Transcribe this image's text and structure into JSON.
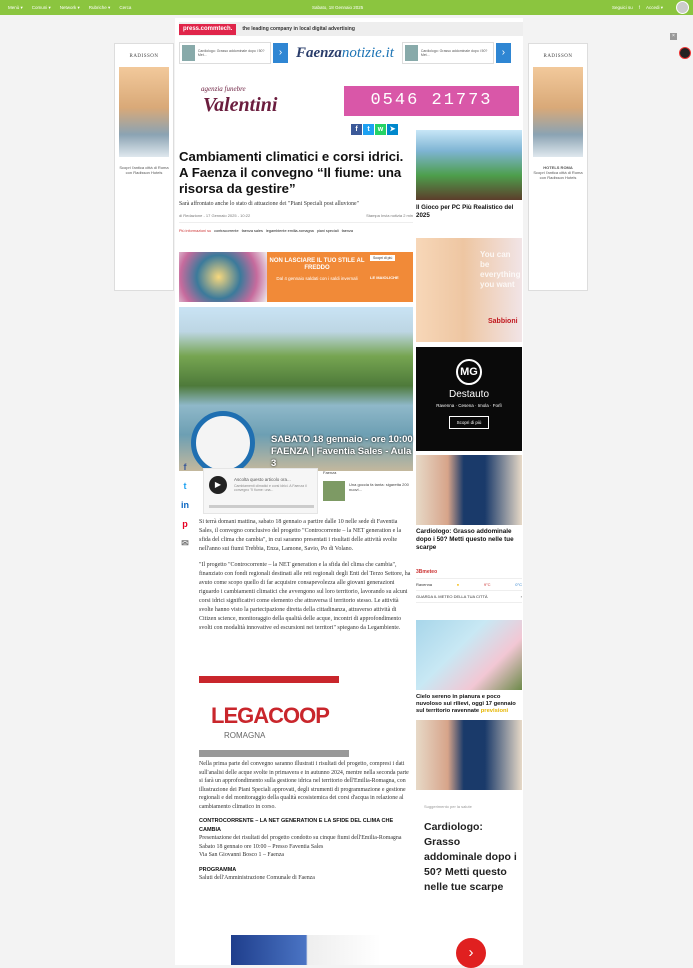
{
  "topbar": {
    "menu": [
      "Menù ▾",
      "Comuni ▾",
      "Network ▾",
      "Rubriche ▾",
      "Cerca"
    ],
    "date": "Sabato, 18 Gennaio 2025",
    "right": [
      "Seguici su",
      "f",
      "Accedi ▾"
    ]
  },
  "press": {
    "logo": "press.commtech.",
    "tagline": "the leading company in local digital advertising"
  },
  "faenza": {
    "card_left": "Cardiologo: Grasso addominale dopo i 50? Met...",
    "card_right": "Cardiologo: Grasso addominale dopo i 50? Met...",
    "logo_main": "Faenza",
    "logo_suffix": "notizie.it"
  },
  "funebre": {
    "top": "agenzia funebre",
    "name": "Valentini",
    "phone": "0546 21773"
  },
  "ads": {
    "hotel_name": "RADISSON",
    "hotel_sub": "HOTELS ROMA",
    "hotel_text": "Scopri l'antica città di Roma con Radisson Hotels",
    "promo_title": "NON LASCIARE IL TUO STILE AL FREDDO",
    "promo_sub": "Dal 4 gennaio saldati con i saldi invernali",
    "promo_brand": "LE MAIOLICHE",
    "promo_btn": "Scopri di più",
    "legacoop": "LEGACOOP",
    "legacoop_sub": "ROMAGNA"
  },
  "article": {
    "title": "Cambiamenti climatici e corsi idrici. A Faenza il convegno “Il fiume: una risorsa da gestire”",
    "subtitle": "Sarà affrontato anche lo stato di attuazione dei \"Piani Speciali post alluvione\"",
    "author": "di Redazione - 17 Gennaio 2025 - 10:22",
    "actions": "Stampa   Invia notizia   2 min",
    "tags_label": "Più informazioni su",
    "tags": [
      "contracorrente",
      "faenza sales",
      "legambiente emilia-romagna",
      "piani speciali",
      "faenza"
    ],
    "hero_text": "SABATO 18 gennaio - ore 10:00\nFAENZA | Faventia Sales - Aula 3",
    "p1": "Si terrà domani mattina, sabato 18 gennaio a partire dalle 10 nelle sede di Faventia Sales, il convegno conclusivo del progetto \"Controcorrente – la NET generation e la sfida del clima che cambia\", in cui saranno presentati i risultati delle attività svolte nell'anno sui fiumi Trebbia, Enza, Lamone, Savio, Po di Volano.",
    "p2": "\"Il progetto \"Controcorrente – la NET generation e la sfida del clima che cambia\", finanziato con fondi regionali destinati alle reti regionali degli Enti del Terzo Settore, ha avuto come scopo quello di far acquisire consapevolezza alle giovani generazioni riguardo i cambiamenti climatici che avvengono sul loro territorio, lavorando su alcuni corsi idrici significativi come elemento che attraversa il territorio stesso. Le attività svolte hanno visto la partecipazione diretta della cittadinanza, attraverso attività di Citizen science, monitoraggio della qualità delle acque, incontri di approfondimento svolti con modalità innovative ed escursioni nei territori\" spiegano da Legambiente.",
    "p3": "Nella prima parte del convegno saranno illustrati i risultati del progetto, compresi i dati sull'analisi delle acque svolte in primavera e in autunno 2024, mentre nella seconda parte si farà un approfondimento sulla gestione idrica nel territorio dell'Emilia-Romagna, con illustrazione dei Piani Speciali approvati, degli strumenti di programmazione e gestione regionali e del monitoraggio della qualità ecosistemica dei corsi d'acqua in relazione al cambiamento climatico in corso.",
    "h1": "CONTROCORRENTE – LA NET GENERATION E LA SFIDE DEL CLIMA CHE CAMBIA",
    "p4": "Presentazione dei risultati del progetto condotto su cinque fiumi dell'Emilia-Romagna\nSabato 18 gennaio ore 10:00 – Presso Faventia Sales\nVia San Giovanni Bosco 1 – Faenza",
    "h2": "PROGRAMMA",
    "p5": "Saluti dell'Amministrazione Comunale di Faenza"
  },
  "audio": {
    "title": "Ascolta questo articolo ora...",
    "desc": "Cambiamenti climatici e corsi idrici. A Faenza il convegno \"Il fiume: una...",
    "related_label": "Faenza",
    "related_text": "Una goccia fa tanta: sigaretta 200 nuovi..."
  },
  "sidebar": {
    "game_title": "Il Gioco per PC Più Realistico del 2025",
    "beauty_text": "You can be everything you want",
    "beauty_brand": "Sabbioni",
    "dest_name": "Destauto",
    "dest_cities": "Ravenna · Cesena · Imola · Forlì",
    "dest_btn": "Scopri di più",
    "doctor_title": "Cardiologo: Grasso addominale dopo i 50? Metti questo nelle tue scarpe",
    "meteo_logo": "3Bmeteo",
    "meteo_city": "Ravenna",
    "meteo_min": "9°C",
    "meteo_max": "0°C",
    "meteo_link": "GUARDA IL METEO DELLA TUA CITTÀ",
    "sky_title": "Cielo sereno in pianura e poco nuvoloso sui rilievi, oggi 17 gennaio sul territorio ravennate",
    "sky_sub": "previsioni",
    "suggest": "Suggerimento per la salute",
    "doctor2_title": "Cardiologo: Grasso addominale dopo i 50? Metti questo nelle tue scarpe"
  }
}
